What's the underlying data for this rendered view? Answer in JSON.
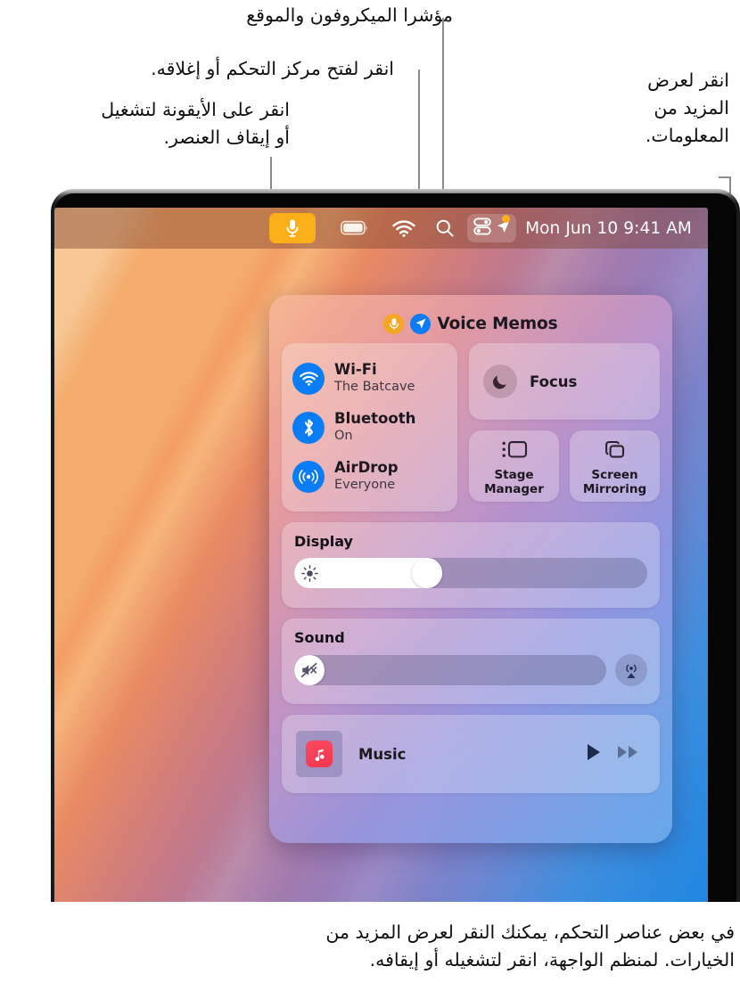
{
  "callouts": {
    "mic_location": "مؤشرا الميكروفون والموقع",
    "open_close_cc": "انقر لفتح مركز التحكم أو إغلاقه.",
    "click_icon": "انقر على الأيقونة لتشغيل\nأو إيقاف العنصر.",
    "show_more_info": "انقر لعرض\nالمزيد من\nالمعلومات.",
    "bottom_note": "في بعض عناصر التحكم، يمكنك النقر لعرض المزيد من\nالخيارات. لمنظم الواجهة، انقر لتشغيله أو إيقافه."
  },
  "menubar": {
    "mic_indicator_icon": "microphone-icon",
    "battery_icon": "battery-icon",
    "wifi_icon": "wifi-icon",
    "search_icon": "search-icon",
    "control_center_icon": "control-center-icon",
    "location_icon": "location-arrow-icon",
    "location_dot_color": "#fbb019",
    "clock": "Mon Jun 10  9:41 AM"
  },
  "control_center": {
    "header": {
      "mic_icon": "microphone-icon",
      "location_icon": "location-arrow-icon",
      "title": "Voice Memos"
    },
    "connectivity": [
      {
        "icon": "wifi-icon",
        "name": "Wi-Fi",
        "status": "The Batcave"
      },
      {
        "icon": "bluetooth-icon",
        "name": "Bluetooth",
        "status": "On"
      },
      {
        "icon": "airdrop-icon",
        "name": "AirDrop",
        "status": "Everyone"
      }
    ],
    "focus": {
      "icon": "moon-icon",
      "label": "Focus"
    },
    "mini_tiles": [
      {
        "icon": "stage-manager-icon",
        "label": "Stage\nManager"
      },
      {
        "icon": "screen-mirroring-icon",
        "label": "Screen\nMirroring"
      }
    ],
    "display": {
      "title": "Display",
      "icon": "brightness-icon",
      "value_percent": 42
    },
    "sound": {
      "title": "Sound",
      "icon": "mute-speaker-icon",
      "value_percent": 0,
      "airplay_icon": "airplay-audio-icon"
    },
    "music": {
      "app_icon": "music-note-icon",
      "label": "Music",
      "play_icon": "play-icon",
      "next_icon": "fast-forward-icon"
    }
  },
  "colors": {
    "accent_blue": "#0a7cf5",
    "mic_orange": "#fbb019",
    "music_red": "#fb4a5f",
    "leader_gray": "#8b8b8b"
  }
}
